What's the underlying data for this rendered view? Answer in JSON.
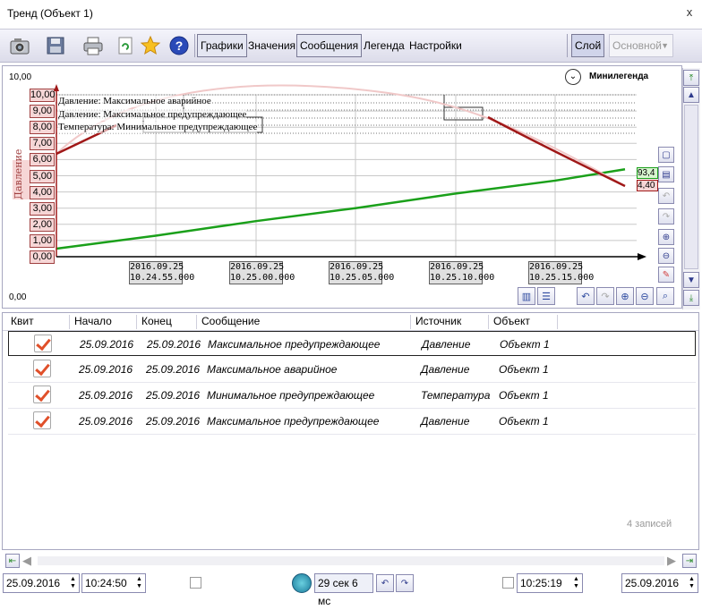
{
  "window": {
    "title": "Тренд (Объект 1)",
    "close_label": "x"
  },
  "toolbar": {
    "icons": [
      "camera-icon",
      "save-icon",
      "print-icon",
      "refresh-icon",
      "star-icon",
      "help-icon"
    ],
    "tabs": [
      {
        "label": "Графики",
        "active": true
      },
      {
        "label": "Значения",
        "active": false
      },
      {
        "label": "Сообщения",
        "active": true
      },
      {
        "label": "Легенда",
        "active": false
      },
      {
        "label": "Настройки",
        "active": false
      }
    ],
    "layer_button": "Слой",
    "layer_value": "Основной"
  },
  "chart": {
    "y_top": "10,00",
    "y_bottom": "0,00",
    "minilegend": "Минилегенда",
    "y_axis_title": "Давление",
    "y_ticks": [
      "10,00",
      "9,00",
      "8,00",
      "7,00",
      "6,00",
      "5,00",
      "4,00",
      "3,00",
      "2,00",
      "1,00",
      "0,00"
    ],
    "x_ticks": [
      {
        "date": "2016.09.25",
        "time": "10.24.55.000"
      },
      {
        "date": "2016.09.25",
        "time": "10.25.00.000"
      },
      {
        "date": "2016.09.25",
        "time": "10.25.05.000"
      },
      {
        "date": "2016.09.25",
        "time": "10.25.10.000"
      },
      {
        "date": "2016.09.25",
        "time": "10.25.15.000"
      }
    ],
    "thresholds": [
      "Давление: Максимальное аварийное",
      "Давление: Максимальное предупреждающее",
      "Температура: Минимальное предупреждающее"
    ],
    "end_values": {
      "green": "93,4",
      "red": "4,40"
    },
    "colors": {
      "green_series": "#1aa01a",
      "red_series": "#a01818",
      "axis_label_bg": "#f6d6d6"
    }
  },
  "chart_data": {
    "type": "line",
    "ylabel": "Давление",
    "ylim": [
      0,
      10
    ],
    "x": [
      "10.24.55",
      "10.25.00",
      "10.25.05",
      "10.25.10",
      "10.25.15"
    ],
    "series": [
      {
        "values": [
          1.3,
          2.2,
          3.0,
          3.9,
          4.7
        ]
      },
      {
        "values": [
          10.9,
          11.2,
          10.8,
          9.0,
          6.2
        ]
      }
    ]
  },
  "table": {
    "headers": [
      "Квит",
      "Начало",
      "Конец",
      "Сообщение",
      "Источник",
      "Объект"
    ],
    "rows": [
      {
        "start": "25.09.2016",
        "end": "25.09.2016",
        "message": "Максимальное предупреждающее",
        "source": "Давление",
        "object": "Объект 1"
      },
      {
        "start": "25.09.2016",
        "end": "25.09.2016",
        "message": "Максимальное аварийное",
        "source": "Давление",
        "object": "Объект 1"
      },
      {
        "start": "25.09.2016",
        "end": "25.09.2016",
        "message": "Минимальное предупреждающее",
        "source": "Температура",
        "object": "Объект 1"
      },
      {
        "start": "25.09.2016",
        "end": "25.09.2016",
        "message": "Максимальное предупреждающее",
        "source": "Давление",
        "object": "Объект 1"
      }
    ],
    "count": "4 записей"
  },
  "bottom": {
    "start_date": "25.09.2016",
    "start_time": "10:24:50",
    "interval": "29 сек 6 мс",
    "end_time": "10:25:19",
    "end_date": "25.09.2016"
  }
}
